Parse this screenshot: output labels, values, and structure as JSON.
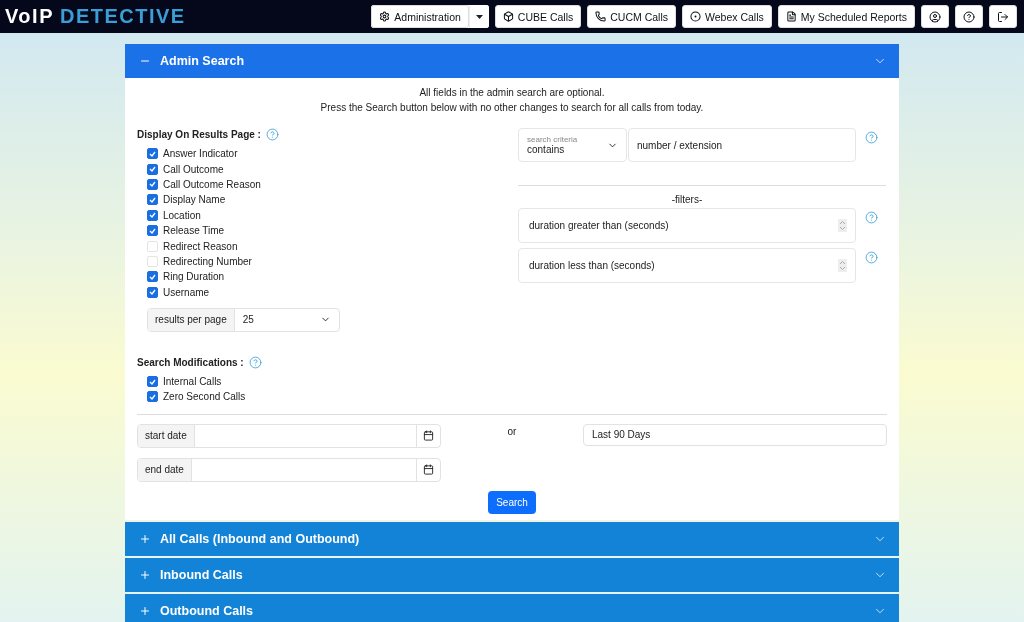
{
  "header": {
    "logo_prefix": "VoIP",
    "logo_suffix": "DETECTIVE",
    "nav": [
      {
        "label": "Administration",
        "has_menu": true
      },
      {
        "label": "CUBE Calls",
        "has_menu": false
      },
      {
        "label": "CUCM Calls",
        "has_menu": false
      },
      {
        "label": "Webex Calls",
        "has_menu": false
      },
      {
        "label": "My Scheduled Reports",
        "has_menu": false
      }
    ]
  },
  "sections": [
    {
      "title": "Admin Search",
      "expanded": true
    },
    {
      "title": "All Calls (Inbound and Outbound)",
      "expanded": false
    },
    {
      "title": "Inbound Calls",
      "expanded": false
    },
    {
      "title": "Outbound Calls",
      "expanded": false
    }
  ],
  "admin_search": {
    "intro": [
      "All fields in the admin search are optional.",
      "Press the Search button below with no other changes to search for all calls from today."
    ],
    "display_label": "Display On Results Page :",
    "display_options": [
      {
        "label": "Answer Indicator",
        "checked": true
      },
      {
        "label": "Call Outcome",
        "checked": true
      },
      {
        "label": "Call Outcome Reason",
        "checked": true
      },
      {
        "label": "Display Name",
        "checked": true
      },
      {
        "label": "Location",
        "checked": true
      },
      {
        "label": "Release Time",
        "checked": true
      },
      {
        "label": "Redirect Reason",
        "checked": false
      },
      {
        "label": "Redirecting Number",
        "checked": false
      },
      {
        "label": "Ring Duration",
        "checked": true
      },
      {
        "label": "Username",
        "checked": true
      }
    ],
    "results_per_page": {
      "label": "results per page",
      "value": "25"
    },
    "modifications_label": "Search Modifications :",
    "modifications": [
      {
        "label": "Internal Calls",
        "checked": true
      },
      {
        "label": "Zero Second Calls",
        "checked": true
      }
    ],
    "search_criteria": {
      "label": "search criteria",
      "value": "contains"
    },
    "number_field": {
      "placeholder": "number / extension"
    },
    "filters_label": "-filters-",
    "filters": [
      {
        "placeholder": "duration greater than (seconds)"
      },
      {
        "placeholder": "duration less than (seconds)"
      }
    ],
    "start_date": {
      "label": "start date"
    },
    "end_date": {
      "label": "end date"
    },
    "or_label": "or",
    "range": {
      "value": "Last 90 Days"
    },
    "search_button": "Search"
  }
}
